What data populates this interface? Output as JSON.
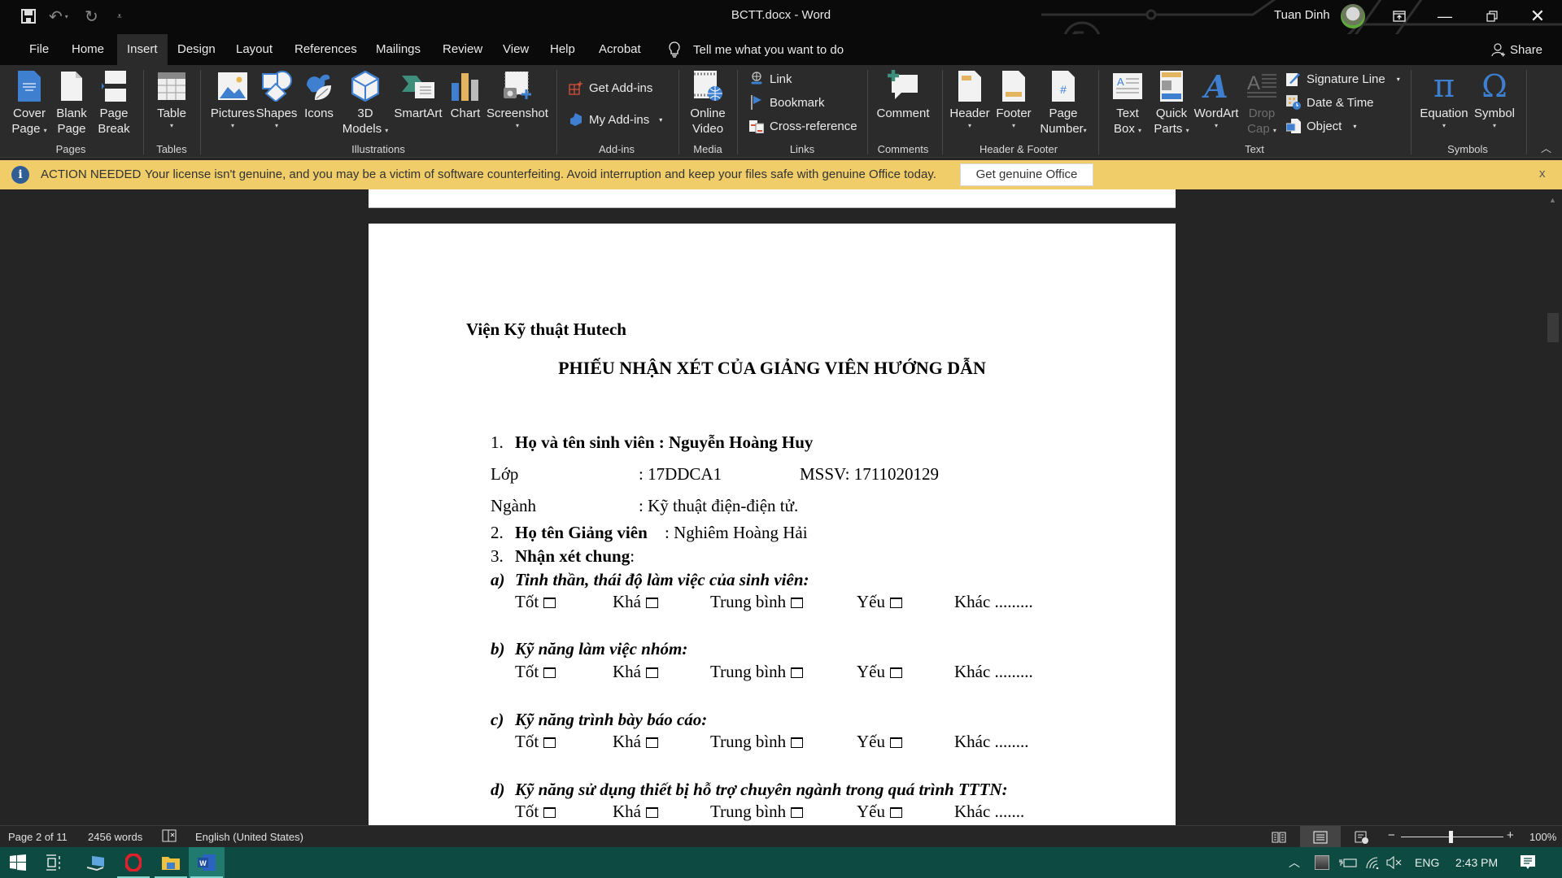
{
  "window": {
    "title": "BCTT.docx  -  Word",
    "user_name": "Tuan Dinh"
  },
  "qat": {
    "save_icon": "save-icon",
    "undo_icon": "undo-icon",
    "redo_icon": "redo-icon",
    "customize_icon": "customize-qat-icon"
  },
  "tabs": [
    {
      "label": "File"
    },
    {
      "label": "Home"
    },
    {
      "label": "Insert",
      "active": true
    },
    {
      "label": "Design"
    },
    {
      "label": "Layout"
    },
    {
      "label": "References"
    },
    {
      "label": "Mailings"
    },
    {
      "label": "Review"
    },
    {
      "label": "View"
    },
    {
      "label": "Help"
    },
    {
      "label": "Acrobat"
    }
  ],
  "tell_me": "Tell me what you want to do",
  "share_label": "Share",
  "ribbon": {
    "groups": [
      {
        "label": "Pages"
      },
      {
        "label": "Tables"
      },
      {
        "label": "Illustrations"
      },
      {
        "label": "Add-ins"
      },
      {
        "label": "Media"
      },
      {
        "label": "Links"
      },
      {
        "label": "Comments"
      },
      {
        "label": "Header & Footer"
      },
      {
        "label": "Text"
      },
      {
        "label": "Symbols"
      }
    ],
    "pages": {
      "cover_page": [
        "Cover",
        "Page"
      ],
      "blank_page": [
        "Blank",
        "Page"
      ],
      "page_break": [
        "Page",
        "Break"
      ]
    },
    "table": "Table",
    "illustrations": {
      "pictures": "Pictures",
      "shapes": "Shapes",
      "icons": "Icons",
      "models": [
        "3D",
        "Models"
      ],
      "smartart": "SmartArt",
      "chart": "Chart",
      "screenshot": "Screenshot"
    },
    "addins": {
      "get": "Get Add-ins",
      "my": "My Add-ins"
    },
    "media": {
      "online_video": [
        "Online",
        "Video"
      ]
    },
    "links": {
      "link": "Link",
      "bookmark": "Bookmark",
      "cross_reference": "Cross-reference"
    },
    "comments": {
      "comment": "Comment"
    },
    "header_footer": {
      "header": "Header",
      "footer": "Footer",
      "page_number": [
        "Page",
        "Number"
      ]
    },
    "text": {
      "text_box": [
        "Text",
        "Box"
      ],
      "quick_parts": [
        "Quick",
        "Parts"
      ],
      "wordart": "WordArt",
      "drop_cap": [
        "Drop",
        "Cap"
      ],
      "signature_line": "Signature Line",
      "date_time": "Date & Time",
      "object": "Object"
    },
    "symbols": {
      "equation": "Equation",
      "symbol": "Symbol"
    }
  },
  "message_bar": {
    "label": "ACTION NEEDED",
    "message": "Your license isn't genuine, and you may be a victim of software counterfeiting. Avoid interruption and keep your files safe with genuine Office today.",
    "button": "Get genuine Office",
    "close": "x"
  },
  "document": {
    "institute": "Viện Kỹ thuật Hutech",
    "title": "PHIẾU NHẬN XÉT CỦA GIẢNG VIÊN HƯỚNG DẪN",
    "item1": {
      "num": "1.",
      "label": "Họ và tên sinh viên : Nguyễn Hoàng Huy"
    },
    "class_label": "Lớp",
    "class_value": ": 17DDCA1",
    "mssv": "MSSV: 1711020129",
    "major_label": "Ngành",
    "major_value": ": Kỹ thuật điện-điện tử.",
    "item2": {
      "num": "2.",
      "label": "Họ tên Giảng viên",
      "value": ": Nghiêm Hoàng Hải"
    },
    "item3": {
      "num": "3.",
      "label": "Nhận xét chung",
      "suffix": ":"
    },
    "sections": [
      {
        "letter": "a)",
        "title": "Tinh thần, thái độ làm việc của sinh viên:",
        "other": "Khác ........."
      },
      {
        "letter": "b)",
        "title": "Kỹ năng làm việc nhóm:",
        "other": "Khác ........."
      },
      {
        "letter": "c)",
        "title": "Kỹ năng trình bày báo cáo:",
        "other": "Khác ........"
      },
      {
        "letter": "d)",
        "title": "Kỹ năng sử dụng thiết bị hỗ trợ chuyên ngành trong quá trình TTTN:",
        "other": "Khác ......."
      }
    ],
    "ratings": [
      "Tốt",
      "Khá",
      "Trung bình",
      "Yếu"
    ]
  },
  "status_bar": {
    "page": "Page 2 of 11",
    "words": "2456 words",
    "language": "English (United States)",
    "zoom": "100%",
    "zoom_level_percent": 100
  },
  "taskbar": {
    "tray_lang": "ENG",
    "time": "2:43 PM"
  }
}
